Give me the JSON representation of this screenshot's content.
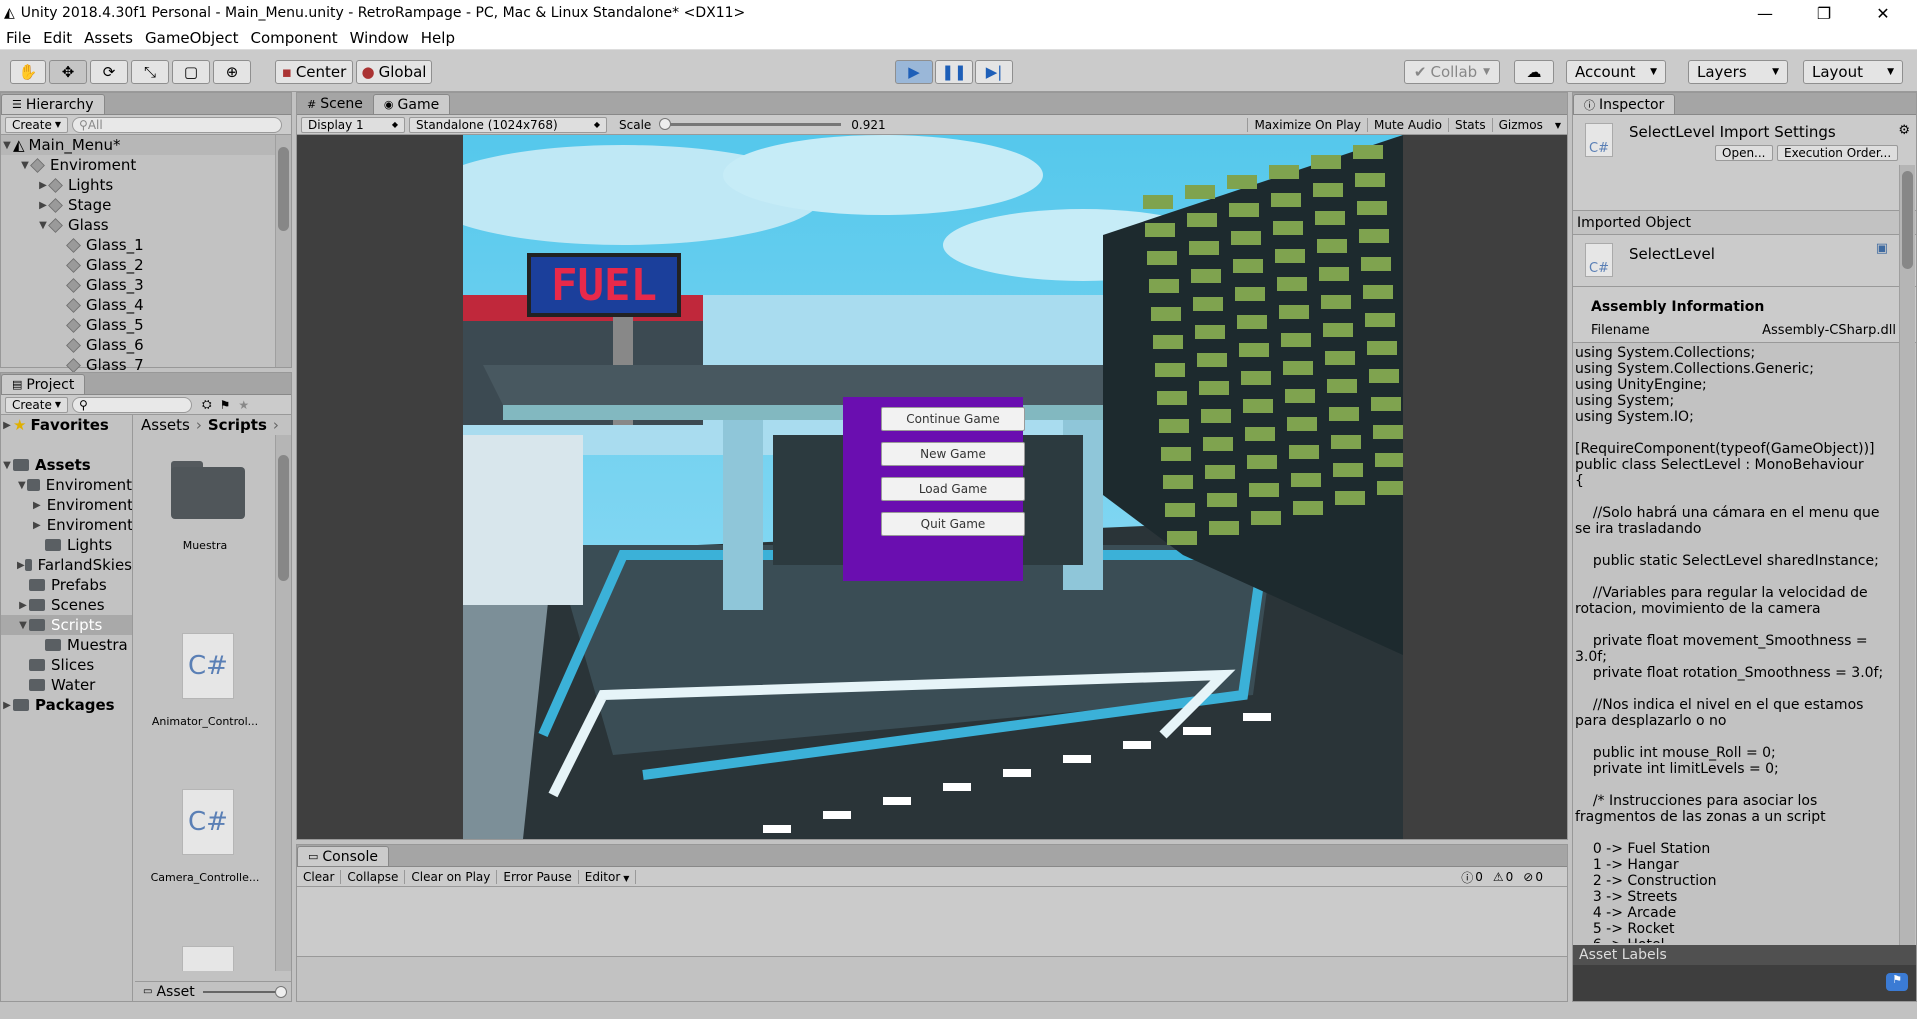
{
  "window": {
    "title": "Unity 2018.4.30f1 Personal - Main_Menu.unity - RetroRampage - PC, Mac & Linux Standalone* <DX11>",
    "minimize": "—",
    "restore": "❐",
    "close": "✕"
  },
  "menu": [
    "File",
    "Edit",
    "Assets",
    "GameObject",
    "Component",
    "Window",
    "Help"
  ],
  "toolbar": {
    "pivot_label": "Center",
    "space_label": "Global",
    "collab_label": "Collab",
    "account_label": "Account",
    "layers_label": "Layers",
    "layout_label": "Layout"
  },
  "hierarchy": {
    "tab": "Hierarchy",
    "create": "Create",
    "search_placeholder": "All",
    "scene": "Main_Menu*",
    "items": [
      {
        "label": "Enviroment",
        "indent": 1,
        "expanded": true
      },
      {
        "label": "Lights",
        "indent": 2,
        "expanded": false
      },
      {
        "label": "Stage",
        "indent": 2,
        "expanded": false
      },
      {
        "label": "Glass",
        "indent": 2,
        "expanded": true
      },
      {
        "label": "Glass_1",
        "indent": 3
      },
      {
        "label": "Glass_2",
        "indent": 3
      },
      {
        "label": "Glass_3",
        "indent": 3
      },
      {
        "label": "Glass_4",
        "indent": 3
      },
      {
        "label": "Glass_5",
        "indent": 3
      },
      {
        "label": "Glass_6",
        "indent": 3
      },
      {
        "label": "Glass_7",
        "indent": 3
      }
    ]
  },
  "project": {
    "tab": "Project",
    "create": "Create",
    "favorites": "Favorites",
    "assets": "Assets",
    "tree": [
      "Enviroment",
      "Enviroment",
      "Enviroment",
      "Lights",
      "FarlandSkies",
      "Prefabs",
      "Scenes",
      "Scripts",
      "Muestra",
      "Slices",
      "Water"
    ],
    "packages": "Packages",
    "breadcrumb": [
      "Assets",
      "Scripts"
    ],
    "files": [
      "Muestra",
      "Animator_Control...",
      "Camera_Controlle..."
    ],
    "footer": "Asset"
  },
  "scene_tabs": {
    "scene": "Scene",
    "game": "Game"
  },
  "game_bar": {
    "display": "Display 1",
    "resolution": "Standalone (1024x768)",
    "scale_label": "Scale",
    "scale_value": "0.921",
    "scale_fraction": 0.02,
    "maximize": "Maximize On Play",
    "mute": "Mute Audio",
    "stats": "Stats",
    "gizmos": "Gizmos"
  },
  "game": {
    "sign_text": "FUEL",
    "menu_buttons": [
      "Continue Game",
      "New Game",
      "Load Game",
      "Quit Game"
    ]
  },
  "console": {
    "tab": "Console",
    "buttons": [
      "Clear",
      "Collapse",
      "Clear on Play",
      "Error Pause",
      "Editor"
    ],
    "counts": {
      "logs": "0",
      "warnings": "0",
      "errors": "0"
    }
  },
  "inspector": {
    "tab": "Inspector",
    "title": "SelectLevel Import Settings",
    "open": "Open...",
    "execution_order": "Execution Order...",
    "imported_object": "Imported Object",
    "object_name": "SelectLevel",
    "assembly_header": "Assembly Information",
    "filename_label": "Filename",
    "filename_value": "Assembly-CSharp.dll",
    "code": "using System.Collections;\nusing System.Collections.Generic;\nusing UnityEngine;\nusing System;\nusing System.IO;\n\n[RequireComponent(typeof(GameObject))]\npublic class SelectLevel : MonoBehaviour\n{\n\n    //Solo habrá una cámara en el menu que se ira trasladando\n\n    public static SelectLevel sharedInstance;\n\n    //Variables para regular la velocidad de rotacion, movimiento de la camera\n\n    private float movement_Smoothness = 3.0f;\n    private float rotation_Smoothness = 3.0f;\n\n    //Nos indica el nivel en el que estamos para desplazarlo o no\n\n    public int mouse_Roll = 0;\n    private int limitLevels = 0;\n\n    /* Instrucciones para asociar los fragmentos de las zonas a un script\n\n    0 -> Fuel Station\n    1 -> Hangar\n    2 -> Construction\n    3 -> Streets\n    4 -> Arcade\n    5 -> Rocket\n    6 -> Hotel",
    "asset_labels": "Asset Labels"
  }
}
